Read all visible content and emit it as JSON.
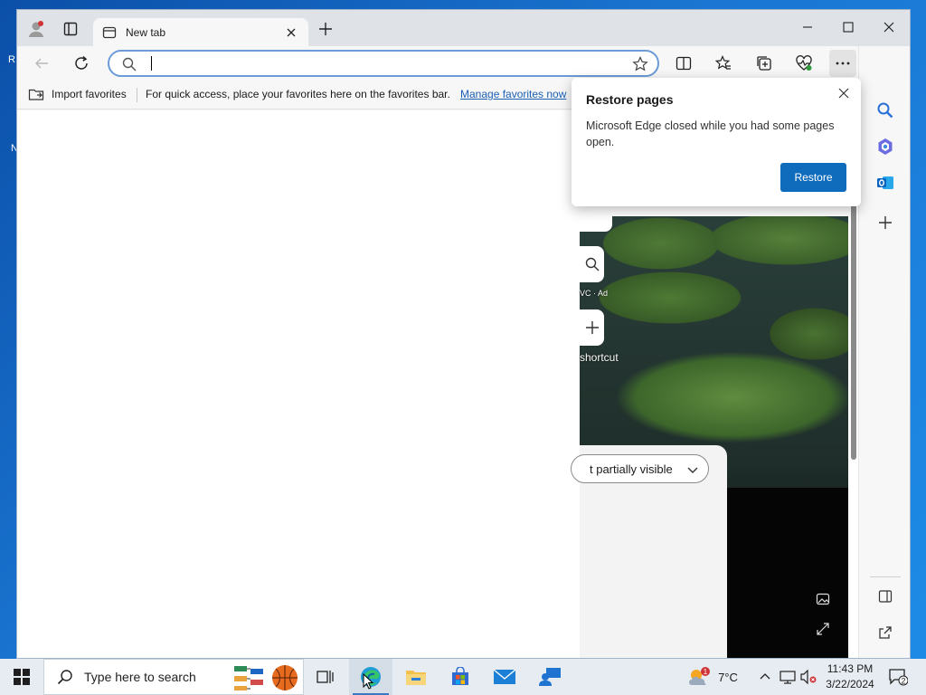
{
  "desktop": {
    "icon_label_a": "R",
    "icon_label_b": "N"
  },
  "browser": {
    "tab": {
      "title": "New tab"
    },
    "address": {
      "value": "",
      "placeholder": ""
    },
    "favorites_bar": {
      "import_label": "Import favorites",
      "hint": "For quick access, place your favorites here on the favorites bar.",
      "manage_link": "Manage favorites now"
    },
    "new_tab_page": {
      "ad_label": "VC · Ad",
      "add_shortcut_label": "shortcut",
      "feed_selector": "t partially visible"
    }
  },
  "restore_popup": {
    "title": "Restore pages",
    "message": "Microsoft Edge closed while you had some pages open.",
    "button": "Restore"
  },
  "taskbar": {
    "search_placeholder": "Type here to search",
    "weather_temp": "7°C",
    "weather_badge": "1",
    "time": "11:43 PM",
    "date": "3/22/2024",
    "notification_count": "2"
  },
  "colors": {
    "accent": "#0f6cbd",
    "link": "#1a5fb4",
    "taskbar": "#e6ecf2"
  }
}
